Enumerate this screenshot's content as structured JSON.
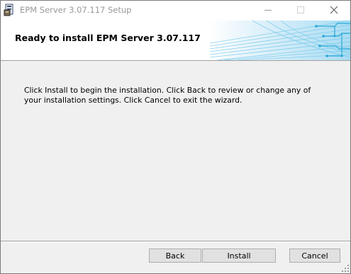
{
  "window": {
    "title": "EPM Server 3.07.117 Setup",
    "icons": {
      "app": "installer-icon",
      "minimize": "minimize-icon",
      "maximize": "maximize-icon",
      "close": "close-icon"
    }
  },
  "header": {
    "title": "Ready to install EPM Server 3.07.117"
  },
  "body": {
    "text": "Click Install to begin the installation. Click Back to review or change any of your installation settings. Click Cancel to exit the wizard."
  },
  "buttons": {
    "back": "Back",
    "install": "Install",
    "cancel": "Cancel"
  },
  "colors": {
    "banner_accent": "#2aa8d8",
    "window_bg": "#f0f0f0",
    "button_bg": "#e1e1e1"
  }
}
